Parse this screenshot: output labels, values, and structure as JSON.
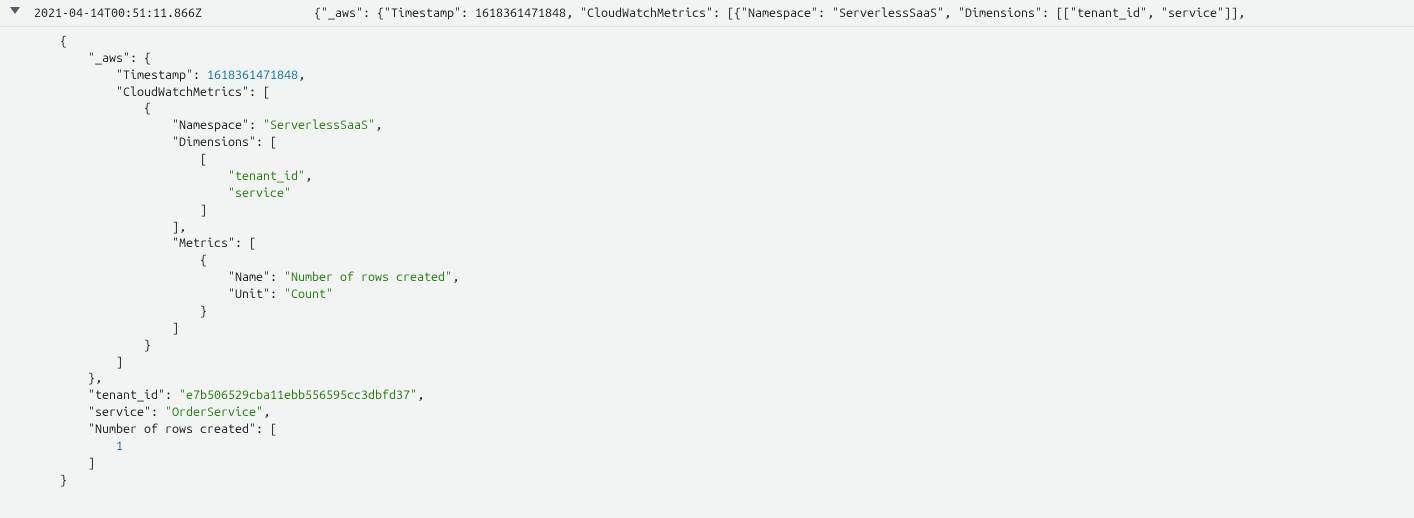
{
  "row": {
    "timestamp_display": "2021-04-14T00:51:11.866Z",
    "raw_message": "{\"_aws\": {\"Timestamp\": 1618361471848, \"CloudWatchMetrics\": [{\"Namespace\": \"ServerlessSaaS\", \"Dimensions\": [[\"tenant_id\", \"service\"]],"
  },
  "json_lines": [
    {
      "indent": 0,
      "parts": [
        {
          "t": "punc",
          "v": "{"
        }
      ]
    },
    {
      "indent": 1,
      "parts": [
        {
          "t": "key",
          "v": "\"_aws\""
        },
        {
          "t": "punc",
          "v": ": {"
        }
      ]
    },
    {
      "indent": 2,
      "parts": [
        {
          "t": "key",
          "v": "\"Timestamp\""
        },
        {
          "t": "punc",
          "v": ": "
        },
        {
          "t": "num",
          "v": "1618361471848"
        },
        {
          "t": "punc",
          "v": ","
        }
      ]
    },
    {
      "indent": 2,
      "parts": [
        {
          "t": "key",
          "v": "\"CloudWatchMetrics\""
        },
        {
          "t": "punc",
          "v": ": ["
        }
      ]
    },
    {
      "indent": 3,
      "parts": [
        {
          "t": "punc",
          "v": "{"
        }
      ]
    },
    {
      "indent": 4,
      "parts": [
        {
          "t": "key",
          "v": "\"Namespace\""
        },
        {
          "t": "punc",
          "v": ": "
        },
        {
          "t": "str",
          "v": "\"ServerlessSaaS\""
        },
        {
          "t": "punc",
          "v": ","
        }
      ]
    },
    {
      "indent": 4,
      "parts": [
        {
          "t": "key",
          "v": "\"Dimensions\""
        },
        {
          "t": "punc",
          "v": ": ["
        }
      ]
    },
    {
      "indent": 5,
      "parts": [
        {
          "t": "punc",
          "v": "["
        }
      ]
    },
    {
      "indent": 6,
      "parts": [
        {
          "t": "str",
          "v": "\"tenant_id\""
        },
        {
          "t": "punc",
          "v": ","
        }
      ]
    },
    {
      "indent": 6,
      "parts": [
        {
          "t": "str",
          "v": "\"service\""
        }
      ]
    },
    {
      "indent": 5,
      "parts": [
        {
          "t": "punc",
          "v": "]"
        }
      ]
    },
    {
      "indent": 4,
      "parts": [
        {
          "t": "punc",
          "v": "],"
        }
      ]
    },
    {
      "indent": 4,
      "parts": [
        {
          "t": "key",
          "v": "\"Metrics\""
        },
        {
          "t": "punc",
          "v": ": ["
        }
      ]
    },
    {
      "indent": 5,
      "parts": [
        {
          "t": "punc",
          "v": "{"
        }
      ]
    },
    {
      "indent": 6,
      "parts": [
        {
          "t": "key",
          "v": "\"Name\""
        },
        {
          "t": "punc",
          "v": ": "
        },
        {
          "t": "str",
          "v": "\"Number of rows created\""
        },
        {
          "t": "punc",
          "v": ","
        }
      ]
    },
    {
      "indent": 6,
      "parts": [
        {
          "t": "key",
          "v": "\"Unit\""
        },
        {
          "t": "punc",
          "v": ": "
        },
        {
          "t": "str",
          "v": "\"Count\""
        }
      ]
    },
    {
      "indent": 5,
      "parts": [
        {
          "t": "punc",
          "v": "}"
        }
      ]
    },
    {
      "indent": 4,
      "parts": [
        {
          "t": "punc",
          "v": "]"
        }
      ]
    },
    {
      "indent": 3,
      "parts": [
        {
          "t": "punc",
          "v": "}"
        }
      ]
    },
    {
      "indent": 2,
      "parts": [
        {
          "t": "punc",
          "v": "]"
        }
      ]
    },
    {
      "indent": 1,
      "parts": [
        {
          "t": "punc",
          "v": "},"
        }
      ]
    },
    {
      "indent": 1,
      "parts": [
        {
          "t": "key",
          "v": "\"tenant_id\""
        },
        {
          "t": "punc",
          "v": ": "
        },
        {
          "t": "str",
          "v": "\"e7b506529cba11ebb556595cc3dbfd37\""
        },
        {
          "t": "punc",
          "v": ","
        }
      ]
    },
    {
      "indent": 1,
      "parts": [
        {
          "t": "key",
          "v": "\"service\""
        },
        {
          "t": "punc",
          "v": ": "
        },
        {
          "t": "str",
          "v": "\"OrderService\""
        },
        {
          "t": "punc",
          "v": ","
        }
      ]
    },
    {
      "indent": 1,
      "parts": [
        {
          "t": "key",
          "v": "\"Number of rows created\""
        },
        {
          "t": "punc",
          "v": ": ["
        }
      ]
    },
    {
      "indent": 2,
      "parts": [
        {
          "t": "num",
          "v": "1"
        }
      ]
    },
    {
      "indent": 1,
      "parts": [
        {
          "t": "punc",
          "v": "]"
        }
      ]
    },
    {
      "indent": 0,
      "parts": [
        {
          "t": "punc",
          "v": "}"
        }
      ]
    }
  ]
}
